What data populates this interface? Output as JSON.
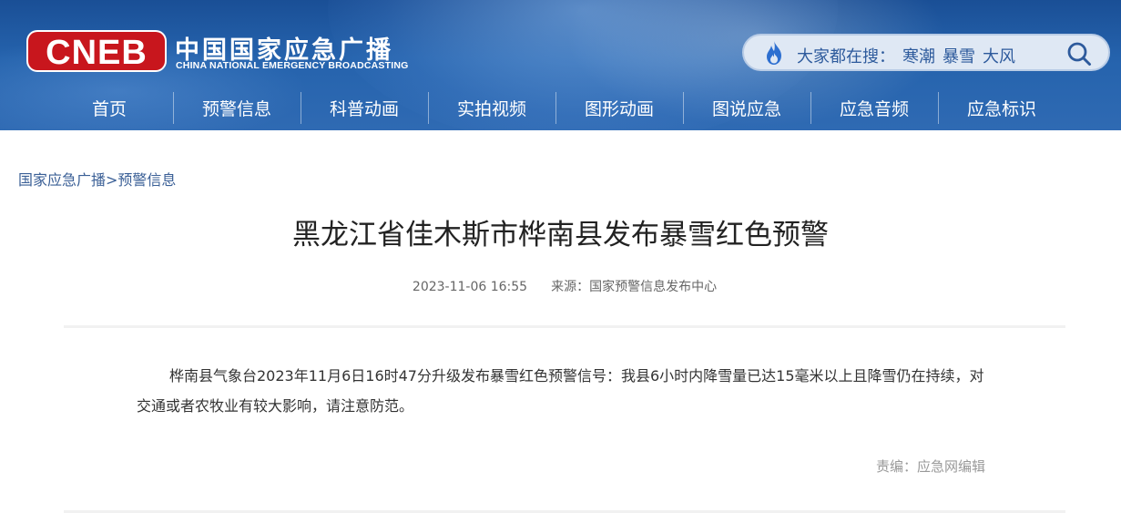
{
  "logo": {
    "mark_text": "CNEB",
    "cn_name": "中国国家应急广播",
    "en_name": "CHINA NATIONAL EMERGENCY BROADCASTING",
    "mark_color": "#c8161d"
  },
  "search": {
    "prefix": "大家都在搜：",
    "keywords": [
      "寒潮",
      "暴雪",
      "大风"
    ],
    "icon": "search-icon",
    "flame_icon": "flame-icon"
  },
  "nav": {
    "items": [
      {
        "label": "首页"
      },
      {
        "label": "预警信息"
      },
      {
        "label": "科普动画"
      },
      {
        "label": "实拍视频"
      },
      {
        "label": "图形动画"
      },
      {
        "label": "图说应急"
      },
      {
        "label": "应急音频"
      },
      {
        "label": "应急标识"
      }
    ]
  },
  "breadcrumb": {
    "home": "国家应急广播",
    "separator": ">",
    "current": "预警信息"
  },
  "article": {
    "title": "黑龙江省佳木斯市桦南县发布暴雪红色预警",
    "datetime": "2023-11-06 16:55",
    "source_label": "来源：",
    "source": "国家预警信息发布中心",
    "body": "桦南县气象台2023年11月6日16时47分升级发布暴雪红色预警信号：我县6小时内降雪量已达15毫米以上且降雪仍在持续，对交通或者农牧业有较大影响，请注意防范。",
    "editor_label": "责编：",
    "editor": "应急网编辑"
  },
  "colors": {
    "header_blue": "#2563ad",
    "link_blue": "#3a5f96",
    "logo_red": "#c8161d"
  }
}
